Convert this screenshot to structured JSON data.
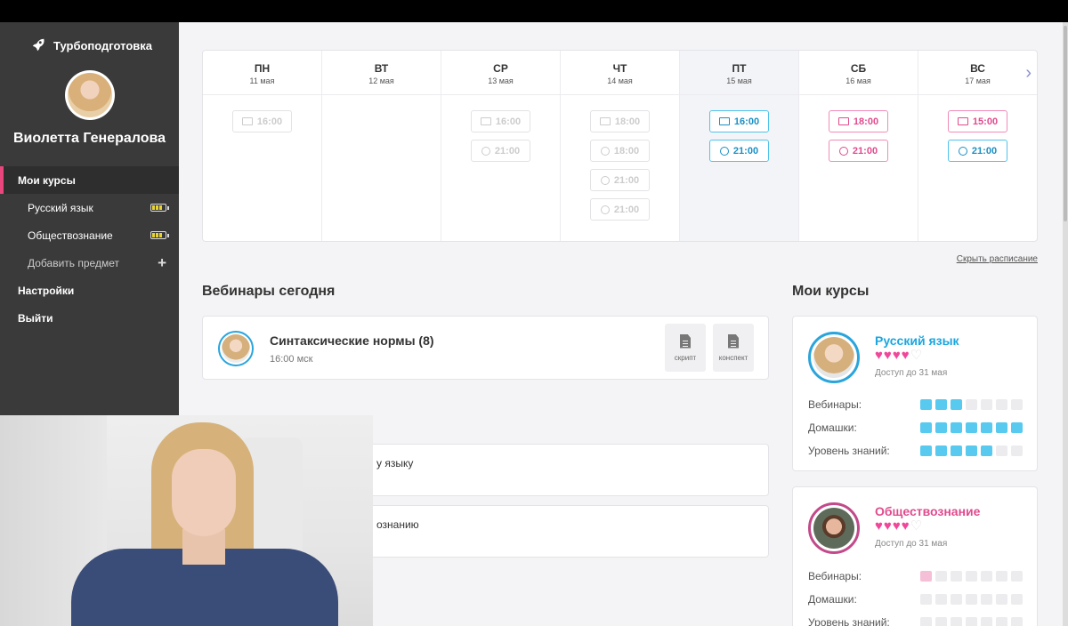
{
  "app": {
    "brand": "Турбоподготовка"
  },
  "user": {
    "name": "Виолетта Генералова"
  },
  "sidebar": {
    "my_courses": "Мои курсы",
    "courses": [
      {
        "label": "Русский язык",
        "battery_level": 0.75
      },
      {
        "label": "Обществознание",
        "battery_level": 0.75
      }
    ],
    "add_subject": "Добавить предмет",
    "settings": "Настройки",
    "logout": "Выйти"
  },
  "schedule": {
    "days": [
      {
        "name": "ПН",
        "date": "11 мая",
        "slots": [
          {
            "time": "16:00",
            "icon": "monitor-icon",
            "state": "past"
          }
        ]
      },
      {
        "name": "ВТ",
        "date": "12 мая",
        "slots": []
      },
      {
        "name": "СР",
        "date": "13 мая",
        "slots": [
          {
            "time": "16:00",
            "icon": "monitor-icon",
            "state": "past"
          },
          {
            "time": "21:00",
            "icon": "clock-icon",
            "state": "past"
          }
        ]
      },
      {
        "name": "ЧТ",
        "date": "14 мая",
        "slots": [
          {
            "time": "18:00",
            "icon": "monitor-icon",
            "state": "past"
          },
          {
            "time": "18:00",
            "icon": "clock-icon",
            "state": "past"
          },
          {
            "time": "21:00",
            "icon": "clock-icon",
            "state": "past"
          },
          {
            "time": "21:00",
            "icon": "clock-icon",
            "state": "past"
          }
        ]
      },
      {
        "name": "ПТ",
        "date": "15 мая",
        "slots": [
          {
            "time": "16:00",
            "icon": "monitor-icon",
            "state": "blue"
          },
          {
            "time": "21:00",
            "icon": "clock-icon",
            "state": "blue"
          }
        ]
      },
      {
        "name": "СБ",
        "date": "16 мая",
        "slots": [
          {
            "time": "18:00",
            "icon": "monitor-icon",
            "state": "pink"
          },
          {
            "time": "21:00",
            "icon": "clock-icon",
            "state": "pink"
          }
        ]
      },
      {
        "name": "ВС",
        "date": "17 мая",
        "slots": [
          {
            "time": "15:00",
            "icon": "monitor-icon",
            "state": "pink"
          },
          {
            "time": "21:00",
            "icon": "clock-icon",
            "state": "blue"
          }
        ]
      }
    ],
    "hide_link": "Скрыть расписание"
  },
  "webinars": {
    "title": "Вебинары сегодня",
    "item": {
      "title": "Синтаксические нормы (8)",
      "time": "16:00 мск",
      "script_label": "скрипт",
      "notes_label": "конспект"
    }
  },
  "homework": {
    "items": [
      "у языку",
      "ознанию"
    ]
  },
  "my_courses": {
    "title": "Мои курсы",
    "metric_labels": {
      "webinars": "Вебинары:",
      "homework": "Домашки:",
      "knowledge": "Уровень знаний:"
    },
    "courses": [
      {
        "name": "Русский язык",
        "hearts_filled": 4,
        "hearts_total": 5,
        "access": "Доступ до 31 мая",
        "color": "#1ba6df",
        "webinars": 3,
        "homework": 7,
        "knowledge": 5,
        "segments": 7
      },
      {
        "name": "Обществознание",
        "hearts_filled": 4,
        "hearts_total": 5,
        "access": "Доступ до 31 мая",
        "color": "#e04a8d",
        "webinars": 1,
        "homework": 0,
        "knowledge": 0,
        "segments": 7
      }
    ]
  },
  "colors": {
    "accent_blue": "#1ba6df",
    "accent_pink": "#e04a8d",
    "sidebar": "#3a3a3a"
  }
}
